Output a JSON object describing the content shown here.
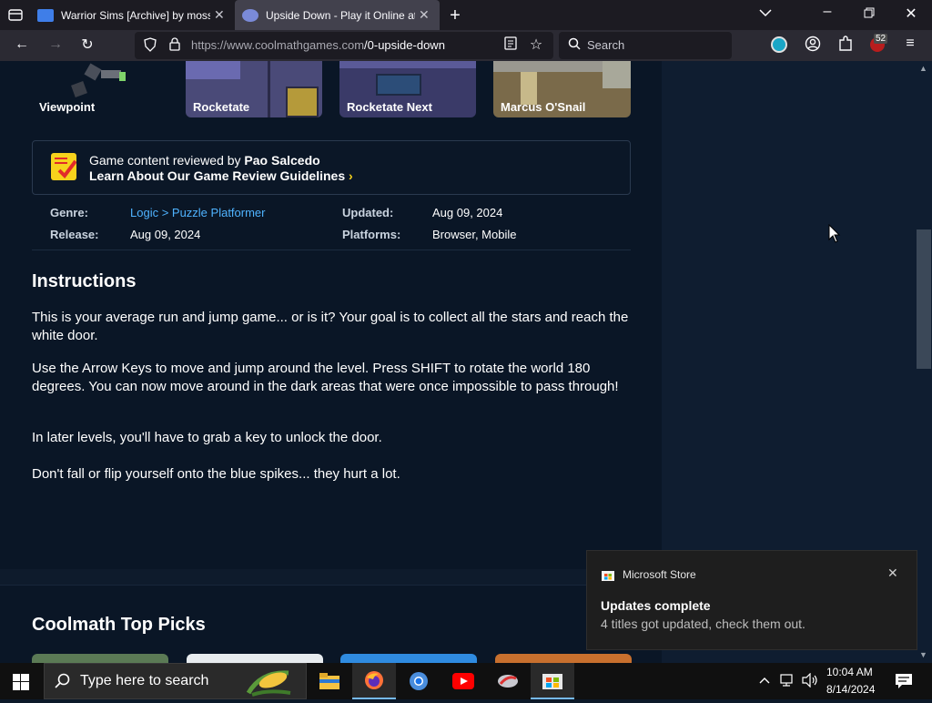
{
  "browser": {
    "tabs": [
      {
        "title": "Warrior Sims [Archive] by moss",
        "active": false
      },
      {
        "title": "Upside Down - Play it Online at",
        "active": true
      }
    ],
    "url_host": "https://www.coolmathgames.com",
    "url_path": "/0-upside-down",
    "search_placeholder": "Search",
    "badge_count": "52"
  },
  "games": [
    {
      "name": "Viewpoint"
    },
    {
      "name": "Rocketate"
    },
    {
      "name": "Rocketate Next"
    },
    {
      "name": "Marcus O'Snail"
    }
  ],
  "review": {
    "prefix": "Game content reviewed by ",
    "reviewer": "Pao Salcedo",
    "link": "Learn About Our Game Review Guidelines"
  },
  "meta": {
    "genre_label": "Genre:",
    "genre_value": "Logic > Puzzle Platformer",
    "release_label": "Release:",
    "release_value": "Aug 09, 2024",
    "updated_label": "Updated:",
    "updated_value": "Aug 09, 2024",
    "platforms_label": "Platforms:",
    "platforms_value": "Browser, Mobile"
  },
  "instructions": {
    "heading": "Instructions",
    "paragraphs": [
      "This is your average run and jump game... or is it? Your goal is to collect all the stars and reach the white door.",
      "Use the Arrow Keys to move and jump around the level. Press SHIFT to rotate the world 180 degrees. You can now move around in the dark areas that were once impossible to pass through!",
      "In later levels, you'll have to grab a key to unlock the door.",
      "Don't fall or flip yourself onto the blue spikes... they hurt a lot."
    ]
  },
  "top_picks": {
    "heading": "Coolmath Top Picks"
  },
  "notification": {
    "app": "Microsoft Store",
    "title": "Updates complete",
    "body": "4 titles got updated, check them out."
  },
  "taskbar": {
    "search_placeholder": "Type here to search",
    "time": "10:04 AM",
    "date": "8/14/2024"
  },
  "colors": {
    "accent_link": "#4fb3ff",
    "page_bg": "#0a1626",
    "review_icon": "#f7d21c"
  }
}
